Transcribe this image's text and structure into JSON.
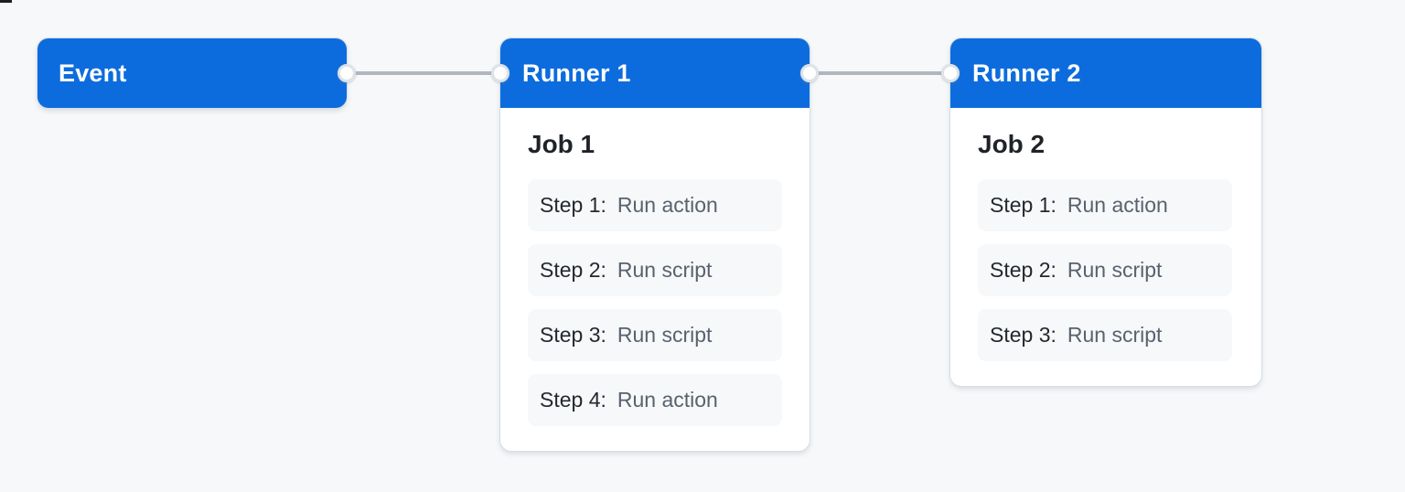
{
  "colors": {
    "accent_blue": "#0d6cdd",
    "page_background": "#f6f8fa",
    "card_background": "#ffffff",
    "step_background": "#f6f8fa",
    "connector_line": "#b0b7bf",
    "header_text": "#ffffff",
    "job_title_text": "#1f2328",
    "step_label_text": "#24292f",
    "step_value_text": "#59626d"
  },
  "event": {
    "label": "Event"
  },
  "runners": [
    {
      "title": "Runner 1",
      "job": {
        "title": "Job 1",
        "steps": [
          {
            "label": "Step 1:",
            "value": "Run action"
          },
          {
            "label": "Step 2:",
            "value": "Run script"
          },
          {
            "label": "Step 3:",
            "value": "Run script"
          },
          {
            "label": "Step 4:",
            "value": "Run action"
          }
        ]
      }
    },
    {
      "title": "Runner 2",
      "job": {
        "title": "Job 2",
        "steps": [
          {
            "label": "Step 1:",
            "value": "Run action"
          },
          {
            "label": "Step 2:",
            "value": "Run script"
          },
          {
            "label": "Step 3:",
            "value": "Run script"
          }
        ]
      }
    }
  ]
}
